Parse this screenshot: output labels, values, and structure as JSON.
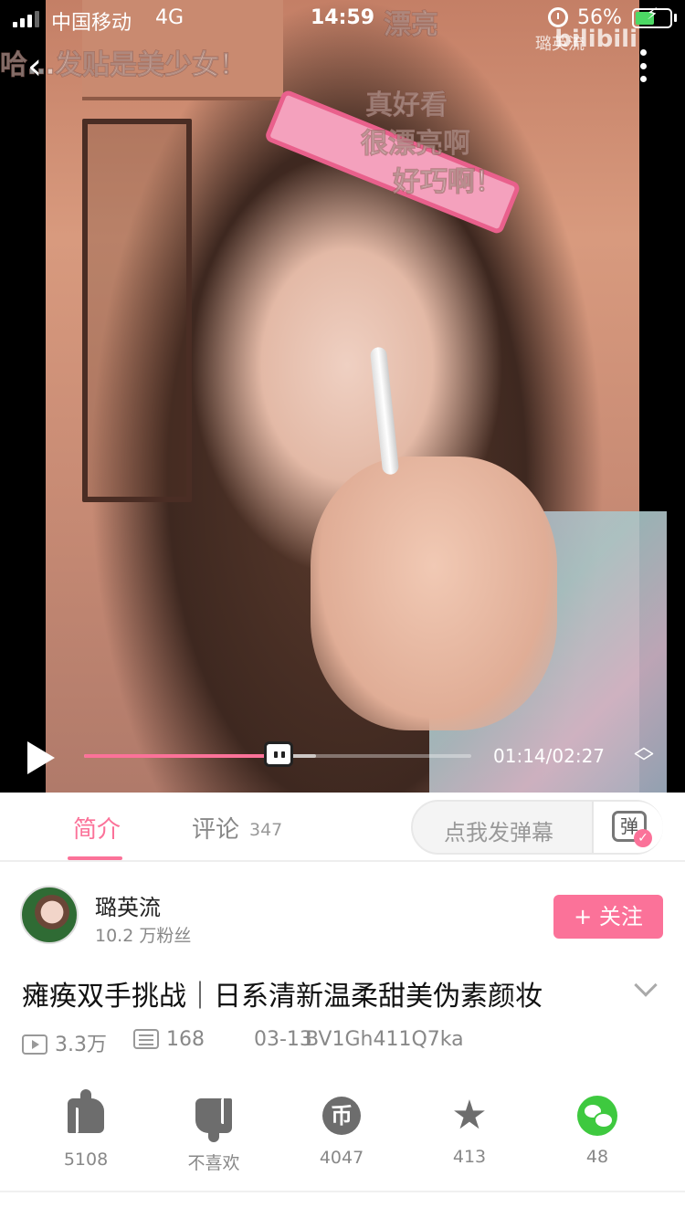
{
  "status_bar": {
    "carrier": "中国移动",
    "network": "4G",
    "time": "14:59",
    "battery": "56%",
    "battery_level": 0.56
  },
  "video": {
    "watermark": "璐英流",
    "watermark_logo": "bilibili",
    "danmaku": [
      "哈…发贴是美少女！",
      "真好看",
      "很漂亮啊",
      "好巧啊！",
      "漂亮"
    ],
    "player": {
      "current_time": "01:14",
      "duration": "02:27",
      "time_display": "01:14/02:27",
      "progress": 0.503,
      "buffered": 0.6
    }
  },
  "tabs": {
    "intro_label": "简介",
    "comments_label": "评论",
    "comments_count": "347",
    "danmaku_placeholder": "点我发弹幕",
    "danmaku_button_glyph": "弹"
  },
  "uploader": {
    "name": "璐英流",
    "fans": "10.2 万粉丝",
    "follow_label": "+ 关注"
  },
  "video_info": {
    "title": "瘫痪双手挑战｜日系清新温柔甜美伪素颜妆",
    "views": "3.3万",
    "danmaku_count": "168",
    "date": "03-13",
    "bvid": "BV1Gh411Q7ka"
  },
  "actions": {
    "like": "5108",
    "dislike": "不喜欢",
    "coin": "4047",
    "coin_glyph": "币",
    "favorite": "413",
    "share": "48"
  },
  "colors": {
    "accent": "#fb7299",
    "wechat": "#3ec93f"
  }
}
